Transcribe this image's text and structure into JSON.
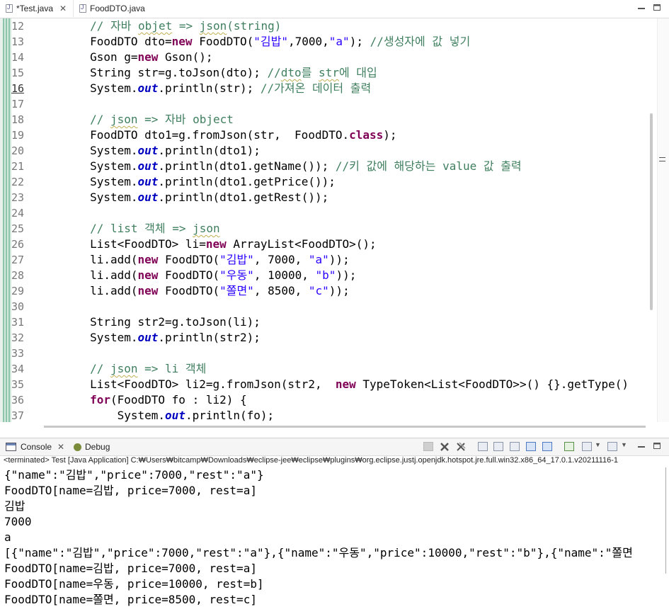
{
  "editor": {
    "tabs": [
      {
        "label": "*Test.java",
        "active": true,
        "close": "✕"
      },
      {
        "label": "FoodDTO.java",
        "active": false
      }
    ],
    "window_controls": {
      "minimize": "▭",
      "maximize": "▭"
    },
    "first_line_number": 12,
    "line_numbers": [
      "12",
      "13",
      "14",
      "15",
      "16",
      "17",
      "18",
      "19",
      "20",
      "21",
      "22",
      "23",
      "24",
      "25",
      "26",
      "27",
      "28",
      "29",
      "30",
      "31",
      "32",
      "33",
      "34",
      "35",
      "36",
      "37"
    ]
  },
  "code_lines": [
    [
      {
        "t": "        "
      },
      {
        "t": "// 자바 ",
        "c": "cm"
      },
      {
        "t": "objet",
        "c": "cm sq"
      },
      {
        "t": " => ",
        "c": "cm"
      },
      {
        "t": "json",
        "c": "cm sq"
      },
      {
        "t": "(string)",
        "c": "cm"
      }
    ],
    [
      {
        "t": "        FoodDTO dto="
      },
      {
        "t": "new",
        "c": "kw"
      },
      {
        "t": " FoodDTO("
      },
      {
        "t": "\"김밥\"",
        "c": "str"
      },
      {
        "t": ",7000,"
      },
      {
        "t": "\"a\"",
        "c": "str"
      },
      {
        "t": "); "
      },
      {
        "t": "//생성자에 값 넣기",
        "c": "cm"
      }
    ],
    [
      {
        "t": "        Gson g="
      },
      {
        "t": "new",
        "c": "kw"
      },
      {
        "t": " Gson();"
      }
    ],
    [
      {
        "t": "        String str=g.toJson(dto); "
      },
      {
        "t": "//",
        "c": "cm"
      },
      {
        "t": "dto",
        "c": "cm sq"
      },
      {
        "t": "를 ",
        "c": "cm"
      },
      {
        "t": "str",
        "c": "cm sq"
      },
      {
        "t": "에 대입",
        "c": "cm"
      }
    ],
    [
      {
        "t": "        System."
      },
      {
        "t": "out",
        "c": "fld"
      },
      {
        "t": ".println(str); "
      },
      {
        "t": "//가져온 데이터 출력",
        "c": "cm"
      }
    ],
    [
      {
        "t": ""
      }
    ],
    [
      {
        "t": "        "
      },
      {
        "t": "// ",
        "c": "cm"
      },
      {
        "t": "json",
        "c": "cm sq"
      },
      {
        "t": " => 자바 object",
        "c": "cm"
      }
    ],
    [
      {
        "t": "        FoodDTO dto1=g.fromJson(str,  FoodDTO."
      },
      {
        "t": "class",
        "c": "kw"
      },
      {
        "t": ");"
      }
    ],
    [
      {
        "t": "        System."
      },
      {
        "t": "out",
        "c": "fld"
      },
      {
        "t": ".println(dto1);"
      }
    ],
    [
      {
        "t": "        System."
      },
      {
        "t": "out",
        "c": "fld"
      },
      {
        "t": ".println(dto1.getName()); "
      },
      {
        "t": "//키 값에 해당하는 value 값 출력",
        "c": "cm"
      }
    ],
    [
      {
        "t": "        System."
      },
      {
        "t": "out",
        "c": "fld"
      },
      {
        "t": ".println(dto1.getPrice());"
      }
    ],
    [
      {
        "t": "        System."
      },
      {
        "t": "out",
        "c": "fld"
      },
      {
        "t": ".println(dto1.getRest());"
      }
    ],
    [
      {
        "t": ""
      }
    ],
    [
      {
        "t": "        "
      },
      {
        "t": "// list 객체 => ",
        "c": "cm"
      },
      {
        "t": "json",
        "c": "cm sq"
      }
    ],
    [
      {
        "t": "        List<FoodDTO> li="
      },
      {
        "t": "new",
        "c": "kw"
      },
      {
        "t": " ArrayList<FoodDTO>();"
      }
    ],
    [
      {
        "t": "        li.add("
      },
      {
        "t": "new",
        "c": "kw"
      },
      {
        "t": " FoodDTO("
      },
      {
        "t": "\"김밥\"",
        "c": "str"
      },
      {
        "t": ", 7000, "
      },
      {
        "t": "\"a\"",
        "c": "str"
      },
      {
        "t": "));"
      }
    ],
    [
      {
        "t": "        li.add("
      },
      {
        "t": "new",
        "c": "kw"
      },
      {
        "t": " FoodDTO("
      },
      {
        "t": "\"우동\"",
        "c": "str"
      },
      {
        "t": ", 10000, "
      },
      {
        "t": "\"b\"",
        "c": "str"
      },
      {
        "t": "));"
      }
    ],
    [
      {
        "t": "        li.add("
      },
      {
        "t": "new",
        "c": "kw"
      },
      {
        "t": " FoodDTO("
      },
      {
        "t": "\"쫄면\"",
        "c": "str"
      },
      {
        "t": ", 8500, "
      },
      {
        "t": "\"c\"",
        "c": "str"
      },
      {
        "t": "));"
      }
    ],
    [
      {
        "t": ""
      }
    ],
    [
      {
        "t": "        String str2=g.toJson(li);"
      }
    ],
    [
      {
        "t": "        System."
      },
      {
        "t": "out",
        "c": "fld"
      },
      {
        "t": ".println(str2);"
      }
    ],
    [
      {
        "t": ""
      }
    ],
    [
      {
        "t": "        "
      },
      {
        "t": "// ",
        "c": "cm"
      },
      {
        "t": "json",
        "c": "cm sq"
      },
      {
        "t": " => li 객체",
        "c": "cm"
      }
    ],
    [
      {
        "t": "        List<FoodDTO> li2=g.fromJson(str2,  "
      },
      {
        "t": "new",
        "c": "kw"
      },
      {
        "t": " TypeToken<List<FoodDTO>>() {}.getType()"
      }
    ],
    [
      {
        "t": "        "
      },
      {
        "t": "for",
        "c": "kw"
      },
      {
        "t": "(FoodDTO fo : li2) {"
      }
    ],
    [
      {
        "t": "            System."
      },
      {
        "t": "out",
        "c": "fld"
      },
      {
        "t": ".println(fo);"
      }
    ]
  ],
  "panel": {
    "tabs": [
      {
        "label": "Console",
        "close": "✕"
      },
      {
        "label": "Debug"
      }
    ],
    "status": "<terminated> Test [Java Application] C:₩Users₩bitcamp₩Downloads₩eclipse-jee₩eclipse₩plugins₩org.eclipse.justj.openjdk.hotspot.jre.full.win32.x86_64_17.0.1.v20211116-1",
    "output": [
      "{\"name\":\"김밥\",\"price\":7000,\"rest\":\"a\"}",
      "FoodDTO[name=김밥, price=7000, rest=a]",
      "김밥",
      "7000",
      "a",
      "[{\"name\":\"김밥\",\"price\":7000,\"rest\":\"a\"},{\"name\":\"우동\",\"price\":10000,\"rest\":\"b\"},{\"name\":\"쫄면",
      "FoodDTO[name=김밥, price=7000, rest=a]",
      "FoodDTO[name=우동, price=10000, rest=b]",
      "FoodDTO[name=쫄면, price=8500, rest=c]"
    ]
  }
}
